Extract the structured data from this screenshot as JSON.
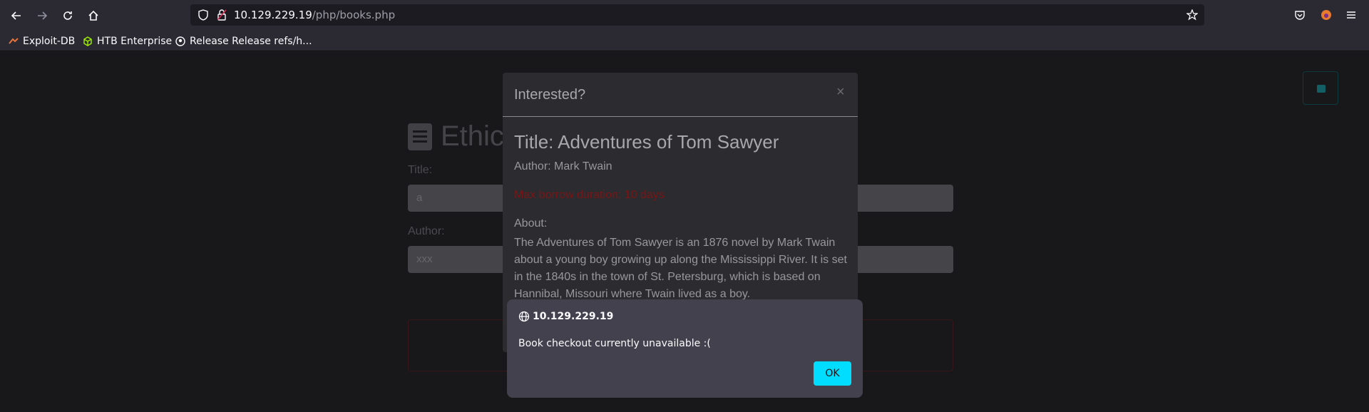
{
  "browser": {
    "url_host": "10.129.229.19",
    "url_path": "/php/books.php",
    "bookmarks": [
      {
        "label": "Exploit-DB",
        "icon": "exploitdb-icon"
      },
      {
        "label": "HTB Enterprise",
        "icon": "cube-icon"
      },
      {
        "label": "Release Release refs/h...",
        "icon": "github-icon"
      }
    ]
  },
  "page": {
    "heading": "Ethic",
    "title_label": "Title:",
    "title_value": "a",
    "author_label": "Author:",
    "author_value": "xxx"
  },
  "modal": {
    "header": "Interested?",
    "close": "×",
    "book_title": "Title: Adventures of Tom Sawyer",
    "author": "Author: Mark Twain",
    "borrow": "Max borrow duration: 10 days",
    "about_label": "About:",
    "about_text": "The Adventures of Tom Sawyer is an 1876 novel by Mark Twain about a young boy growing up along the Mississippi River. It is set in the 1840s in the town of St. Petersburg, which is based on Hannibal, Missouri where Twain lived as a boy."
  },
  "dialog": {
    "origin": "10.129.229.19",
    "message": "Book checkout currently unavailable :(",
    "ok": "OK"
  },
  "colors": {
    "accent": "#00ddff",
    "borrow_red": "#7a1515"
  }
}
